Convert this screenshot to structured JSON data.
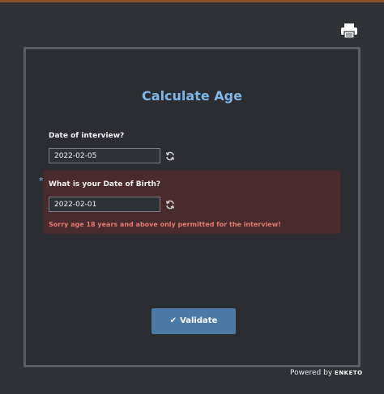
{
  "header": {
    "print_icon": "printer-icon"
  },
  "form": {
    "title": "Calculate Age",
    "questions": [
      {
        "label": "Date of interview?",
        "value": "2022-02-05",
        "icon": "refresh-icon"
      },
      {
        "label": "What is your Date of Birth?",
        "value": "2022-02-01",
        "icon": "refresh-icon",
        "required_mark": "*"
      }
    ],
    "error_message": "Sorry age 18 years and above only permitted for the interview!",
    "validate_label": "Validate"
  },
  "footer": {
    "powered_by": "Powered by",
    "brand": "ENKETO"
  },
  "colors": {
    "accent": "#7fb6e6",
    "error_bg": "#4a2b2d",
    "error_text": "#e27a72",
    "button": "#4b7aa6",
    "top_bar": "#8a4f22"
  }
}
